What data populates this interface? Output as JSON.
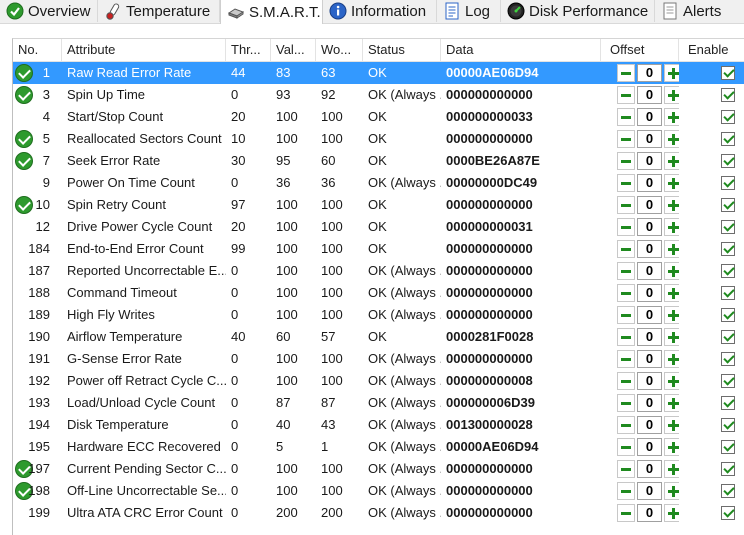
{
  "tabs": [
    {
      "label": "Overview",
      "icon": "check-circle-icon",
      "active": false
    },
    {
      "label": "Temperature",
      "icon": "thermometer-icon",
      "active": false
    },
    {
      "label": "S.M.A.R.T.",
      "icon": "drive-icon",
      "active": true
    },
    {
      "label": "Information",
      "icon": "info-icon",
      "active": false
    },
    {
      "label": "Log",
      "icon": "log-document-icon",
      "active": false
    },
    {
      "label": "Disk Performance",
      "icon": "gauge-icon",
      "active": false
    },
    {
      "label": "Alerts",
      "icon": "alert-document-icon",
      "active": false
    }
  ],
  "columns": {
    "no": "No.",
    "attribute": "Attribute",
    "threshold": "Thr...",
    "value": "Val...",
    "worst": "Wo...",
    "status": "Status",
    "data": "Data",
    "offset": "Offset",
    "enable": "Enable"
  },
  "colors": {
    "selection": "#3399ff",
    "ok_green": "#2e9a2e"
  },
  "rows": [
    {
      "no": "1",
      "attribute": "Raw Read Error Rate",
      "threshold": "44",
      "value": "83",
      "worst": "63",
      "status": "OK",
      "data": "00000AE06D94",
      "offset": "0",
      "enabled": true,
      "ok_icon": true,
      "selected": true
    },
    {
      "no": "3",
      "attribute": "Spin Up Time",
      "threshold": "0",
      "value": "93",
      "worst": "92",
      "status": "OK (Always ...",
      "data": "000000000000",
      "offset": "0",
      "enabled": true,
      "ok_icon": true,
      "selected": false
    },
    {
      "no": "4",
      "attribute": "Start/Stop Count",
      "threshold": "20",
      "value": "100",
      "worst": "100",
      "status": "OK",
      "data": "000000000033",
      "offset": "0",
      "enabled": true,
      "ok_icon": false,
      "selected": false
    },
    {
      "no": "5",
      "attribute": "Reallocated Sectors Count",
      "threshold": "10",
      "value": "100",
      "worst": "100",
      "status": "OK",
      "data": "000000000000",
      "offset": "0",
      "enabled": true,
      "ok_icon": true,
      "selected": false
    },
    {
      "no": "7",
      "attribute": "Seek Error Rate",
      "threshold": "30",
      "value": "95",
      "worst": "60",
      "status": "OK",
      "data": "0000BE26A87E",
      "offset": "0",
      "enabled": true,
      "ok_icon": true,
      "selected": false
    },
    {
      "no": "9",
      "attribute": "Power On Time Count",
      "threshold": "0",
      "value": "36",
      "worst": "36",
      "status": "OK (Always ...",
      "data": "00000000DC49",
      "offset": "0",
      "enabled": true,
      "ok_icon": false,
      "selected": false
    },
    {
      "no": "10",
      "attribute": "Spin Retry Count",
      "threshold": "97",
      "value": "100",
      "worst": "100",
      "status": "OK",
      "data": "000000000000",
      "offset": "0",
      "enabled": true,
      "ok_icon": true,
      "selected": false
    },
    {
      "no": "12",
      "attribute": "Drive Power Cycle Count",
      "threshold": "20",
      "value": "100",
      "worst": "100",
      "status": "OK",
      "data": "000000000031",
      "offset": "0",
      "enabled": true,
      "ok_icon": false,
      "selected": false
    },
    {
      "no": "184",
      "attribute": "End-to-End Error Count",
      "threshold": "99",
      "value": "100",
      "worst": "100",
      "status": "OK",
      "data": "000000000000",
      "offset": "0",
      "enabled": true,
      "ok_icon": false,
      "selected": false
    },
    {
      "no": "187",
      "attribute": "Reported Uncorrectable E...",
      "threshold": "0",
      "value": "100",
      "worst": "100",
      "status": "OK (Always ...",
      "data": "000000000000",
      "offset": "0",
      "enabled": true,
      "ok_icon": false,
      "selected": false
    },
    {
      "no": "188",
      "attribute": "Command Timeout",
      "threshold": "0",
      "value": "100",
      "worst": "100",
      "status": "OK (Always ...",
      "data": "000000000000",
      "offset": "0",
      "enabled": true,
      "ok_icon": false,
      "selected": false
    },
    {
      "no": "189",
      "attribute": "High Fly Writes",
      "threshold": "0",
      "value": "100",
      "worst": "100",
      "status": "OK (Always ...",
      "data": "000000000000",
      "offset": "0",
      "enabled": true,
      "ok_icon": false,
      "selected": false
    },
    {
      "no": "190",
      "attribute": "Airflow Temperature",
      "threshold": "40",
      "value": "60",
      "worst": "57",
      "status": "OK",
      "data": "0000281F0028",
      "offset": "0",
      "enabled": true,
      "ok_icon": false,
      "selected": false
    },
    {
      "no": "191",
      "attribute": "G-Sense Error Rate",
      "threshold": "0",
      "value": "100",
      "worst": "100",
      "status": "OK (Always ...",
      "data": "000000000000",
      "offset": "0",
      "enabled": true,
      "ok_icon": false,
      "selected": false
    },
    {
      "no": "192",
      "attribute": "Power off Retract Cycle C...",
      "threshold": "0",
      "value": "100",
      "worst": "100",
      "status": "OK (Always ...",
      "data": "000000000008",
      "offset": "0",
      "enabled": true,
      "ok_icon": false,
      "selected": false
    },
    {
      "no": "193",
      "attribute": "Load/Unload Cycle Count",
      "threshold": "0",
      "value": "87",
      "worst": "87",
      "status": "OK (Always ...",
      "data": "000000006D39",
      "offset": "0",
      "enabled": true,
      "ok_icon": false,
      "selected": false
    },
    {
      "no": "194",
      "attribute": "Disk Temperature",
      "threshold": "0",
      "value": "40",
      "worst": "43",
      "status": "OK (Always ...",
      "data": "001300000028",
      "offset": "0",
      "enabled": true,
      "ok_icon": false,
      "selected": false
    },
    {
      "no": "195",
      "attribute": "Hardware ECC Recovered",
      "threshold": "0",
      "value": "5",
      "worst": "1",
      "status": "OK (Always ...",
      "data": "00000AE06D94",
      "offset": "0",
      "enabled": true,
      "ok_icon": false,
      "selected": false
    },
    {
      "no": "197",
      "attribute": "Current Pending Sector C...",
      "threshold": "0",
      "value": "100",
      "worst": "100",
      "status": "OK (Always ...",
      "data": "000000000000",
      "offset": "0",
      "enabled": true,
      "ok_icon": true,
      "selected": false
    },
    {
      "no": "198",
      "attribute": "Off-Line Uncorrectable Se...",
      "threshold": "0",
      "value": "100",
      "worst": "100",
      "status": "OK (Always ...",
      "data": "000000000000",
      "offset": "0",
      "enabled": true,
      "ok_icon": true,
      "selected": false
    },
    {
      "no": "199",
      "attribute": "Ultra ATA CRC Error Count",
      "threshold": "0",
      "value": "200",
      "worst": "200",
      "status": "OK (Always ...",
      "data": "000000000000",
      "offset": "0",
      "enabled": true,
      "ok_icon": false,
      "selected": false
    }
  ]
}
